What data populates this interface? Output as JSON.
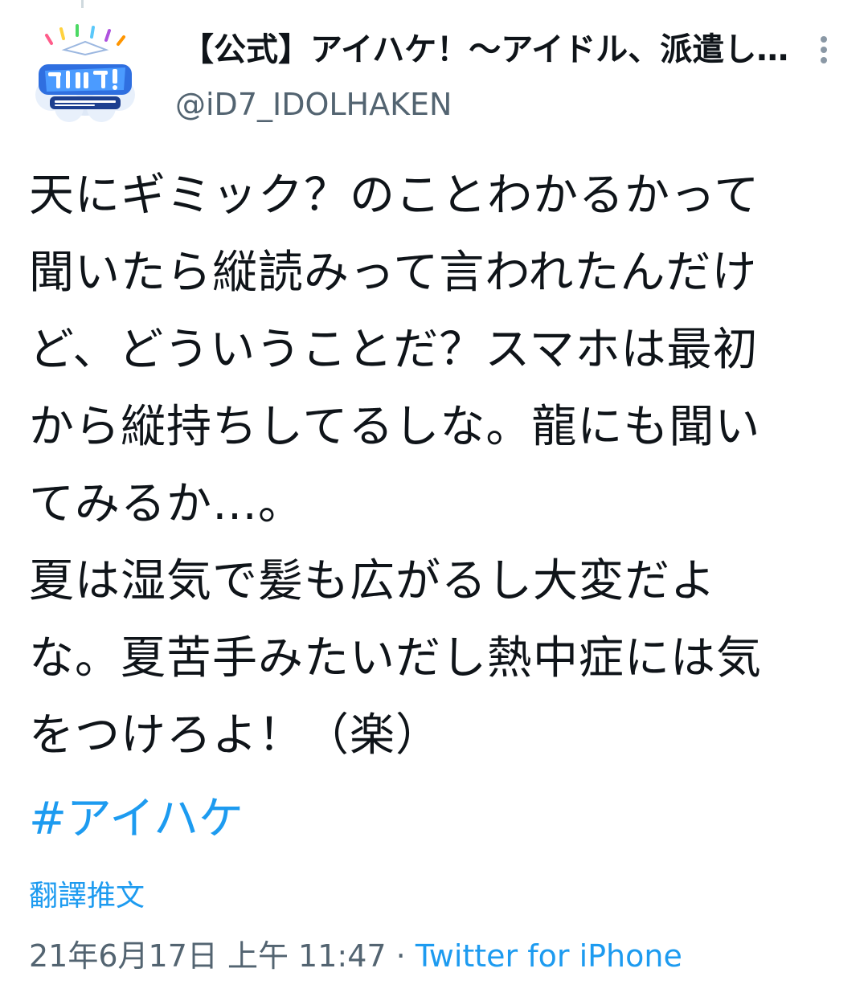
{
  "tweet": {
    "author": {
      "display_name": "【公式】アイハケ！〜アイドル、派遣し…",
      "handle": "@iD7_IDOLHAKEN",
      "avatar_icon": "aihake-logo-avatar"
    },
    "more_icon": "more-vertical-icon",
    "lines": [
      "天にギミック？のことわかるかって",
      "聞いたら縦読みって言われたんだけ",
      "ど、どういうことだ？スマホは最初",
      "から縦持ちしてるしな。龍にも聞い",
      "てみるか…。",
      "夏は湿気で髪も広がるし大変だよ",
      "な。夏苦手みたいだし熱中症には気",
      "をつけろよ！（楽）"
    ],
    "hashtag": "#アイハケ",
    "translate_label": "翻譯推文",
    "timestamp": "21年6月17日 上午 11:47",
    "separator": " · ",
    "source": "Twitter for iPhone"
  },
  "colors": {
    "link": "#1d9bf0",
    "secondary_text": "#536471",
    "primary_text": "#0f1419"
  }
}
